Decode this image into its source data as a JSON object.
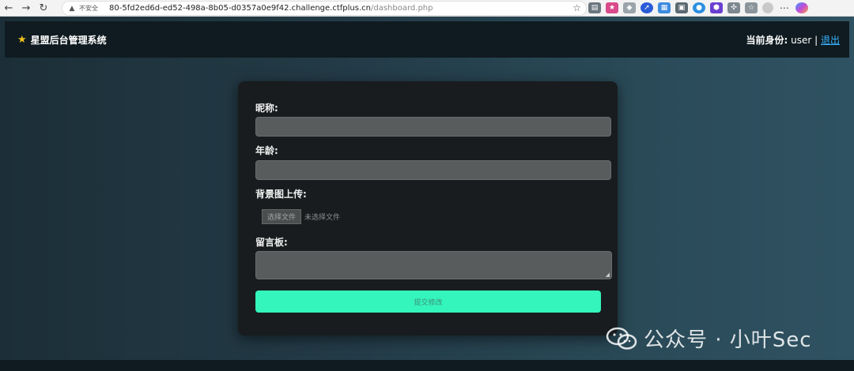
{
  "browser": {
    "insecure_label": "不安全",
    "url_host": "80-5fd2ed6d-ed52-498a-8b05-d0357a0e9f42.challenge.ctfplus.cn",
    "url_path": "/dashboard.php"
  },
  "header": {
    "brand_title": "星盟后台管理系统",
    "identity_label": "当前身份:",
    "username": "user",
    "separator": "|",
    "logout_label": "退出"
  },
  "form": {
    "nickname_label": "昵称:",
    "age_label": "年龄:",
    "bg_upload_label": "背景图上传:",
    "file_button_label": "选择文件",
    "file_status": "未选择文件",
    "message_label": "留言板:",
    "submit_label": "提交修改"
  },
  "watermark": {
    "text": "公众号 · 小叶Sec"
  },
  "colors": {
    "accent": "#34f5bc",
    "header_bg": "#0f1b20",
    "link": "#3ab3ff",
    "star": "#f5c21b"
  }
}
